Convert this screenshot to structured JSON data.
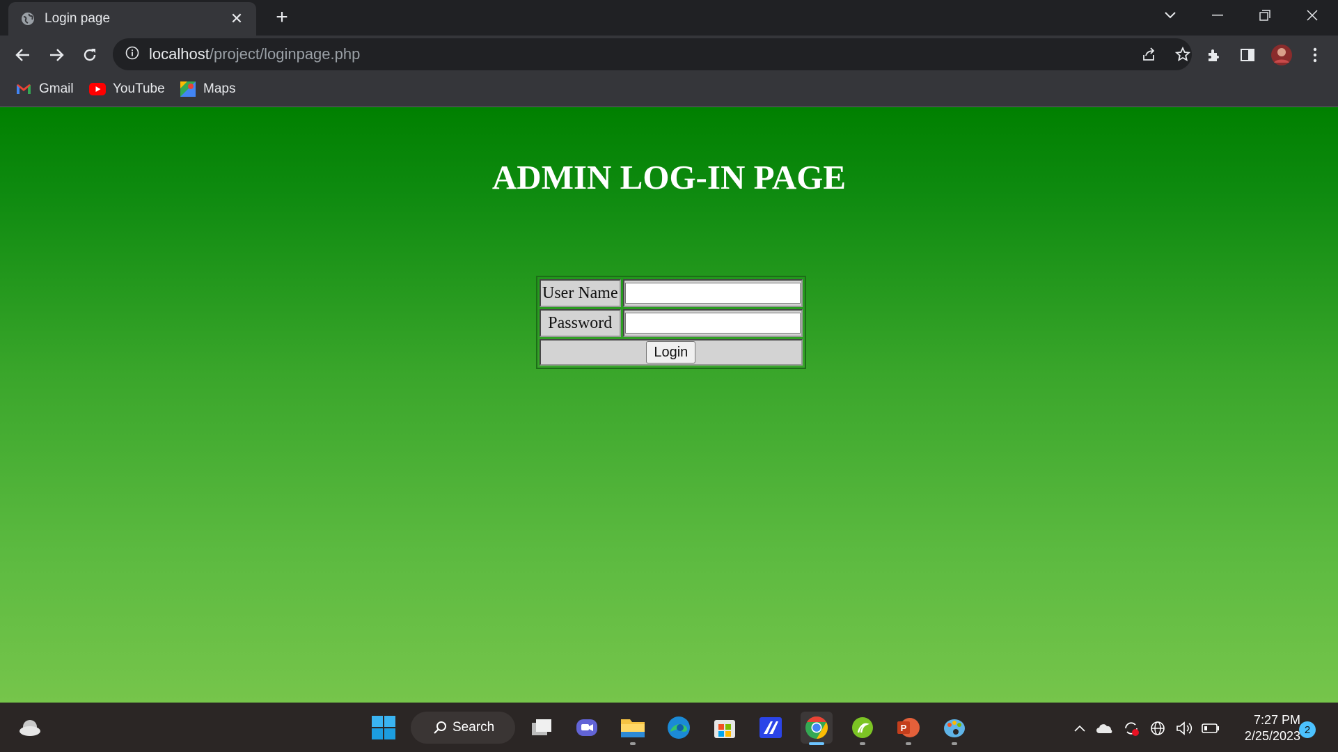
{
  "browser": {
    "tab_title": "Login page",
    "url_host": "localhost",
    "url_path": "/project/loginpage.php",
    "bookmarks": [
      {
        "label": "Gmail",
        "icon": "gmail-icon"
      },
      {
        "label": "YouTube",
        "icon": "youtube-icon"
      },
      {
        "label": "Maps",
        "icon": "maps-icon"
      }
    ]
  },
  "page": {
    "heading": "ADMIN LOG-IN PAGE",
    "form": {
      "username_label": "User Name",
      "username_value": "",
      "password_label": "Password",
      "password_value": "",
      "login_button": "Login"
    }
  },
  "taskbar": {
    "search_label": "Search",
    "time": "7:27 PM",
    "date": "2/25/2023",
    "notification_count": "2"
  },
  "colors": {
    "page_gradient_top": "#008000",
    "page_gradient_bottom": "#76c54b",
    "heading": "#ffffff"
  }
}
